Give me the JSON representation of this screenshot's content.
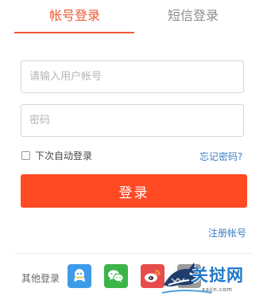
{
  "tabs": {
    "account_login": "帐号登录",
    "sms_login": "短信登录"
  },
  "form": {
    "username_placeholder": "请输入用户帐号",
    "password_placeholder": "密码",
    "remember_label": "下次自动登录",
    "forgot_link": "忘记密码?",
    "login_button": "登录",
    "register_link": "注册帐号"
  },
  "other_login": {
    "label": "其他登录",
    "providers": [
      {
        "name": "QQ",
        "icon": "qq-icon",
        "color": "#3d9be9"
      },
      {
        "name": "WeChat",
        "icon": "wechat-icon",
        "color": "#3bb54a"
      },
      {
        "name": "Weibo",
        "icon": "weibo-icon",
        "color": "#e74c4c"
      }
    ]
  },
  "watermark": {
    "text": "关挝网",
    "url": "xajjn.com"
  },
  "colors": {
    "accent": "#f15a33",
    "button": "#ff4a23",
    "link": "#3a7fc4"
  }
}
